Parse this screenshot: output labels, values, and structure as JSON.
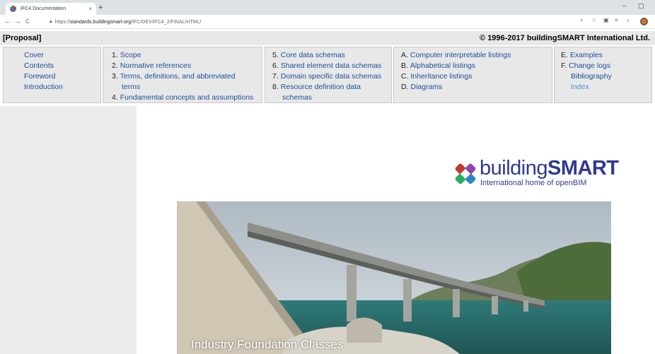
{
  "browser": {
    "tab_title": "IFC4 Documentation",
    "tab_close": "×",
    "new_tab": "+",
    "window_minimize": "–",
    "window_maximize": "▢",
    "nav_back": "←",
    "nav_forward": "→",
    "nav_reload": "C",
    "url_prefix": "https://",
    "url_host": "standards.buildingsmart.org",
    "url_path": "/IFC/DEV/IFC4_2/FINAL/HTML/"
  },
  "header": {
    "status": "[Proposal]",
    "copyright": "© 1996-2017 buildingSMART International Ltd."
  },
  "nav": {
    "front": [
      "Cover",
      "Contents",
      "Foreword",
      "Introduction"
    ],
    "part1": [
      {
        "num": "1.",
        "label": "Scope"
      },
      {
        "num": "2.",
        "label": "Normative references"
      },
      {
        "num": "3.",
        "label": "Terms, definitions, and abbreviated",
        "cont": "terms"
      },
      {
        "num": "4.",
        "label": "Fundamental concepts and assumptions"
      }
    ],
    "part2": [
      {
        "num": "5.",
        "label": "Core data schemas"
      },
      {
        "num": "6.",
        "label": "Shared element data schemas"
      },
      {
        "num": "7.",
        "label": "Domain specific data schemas"
      },
      {
        "num": "8.",
        "label": "Resource definition data",
        "cont": "schemas"
      }
    ],
    "annex1": [
      {
        "num": "A.",
        "label": "Computer interpretable listings"
      },
      {
        "num": "B.",
        "label": "Alphabetical listings"
      },
      {
        "num": "C.",
        "label": "Inheritance listings"
      },
      {
        "num": "D.",
        "label": "Diagrams"
      }
    ],
    "annex2": [
      {
        "num": "E.",
        "label": "Examples"
      },
      {
        "num": "F.",
        "label": "Change logs"
      },
      {
        "num": "",
        "label": "Bibliography"
      },
      {
        "num": "",
        "label": "Index"
      }
    ]
  },
  "logo": {
    "word_light": "building",
    "word_bold": "SMART",
    "tagline": "International home of openBIM"
  },
  "hero": {
    "caption": "Industry Foundation Classes"
  },
  "colors": {
    "link": "#1a4f9c",
    "active_link": "#4a90d9",
    "panel_bg": "#e8e8e8",
    "brand": "#2f3a8f"
  }
}
